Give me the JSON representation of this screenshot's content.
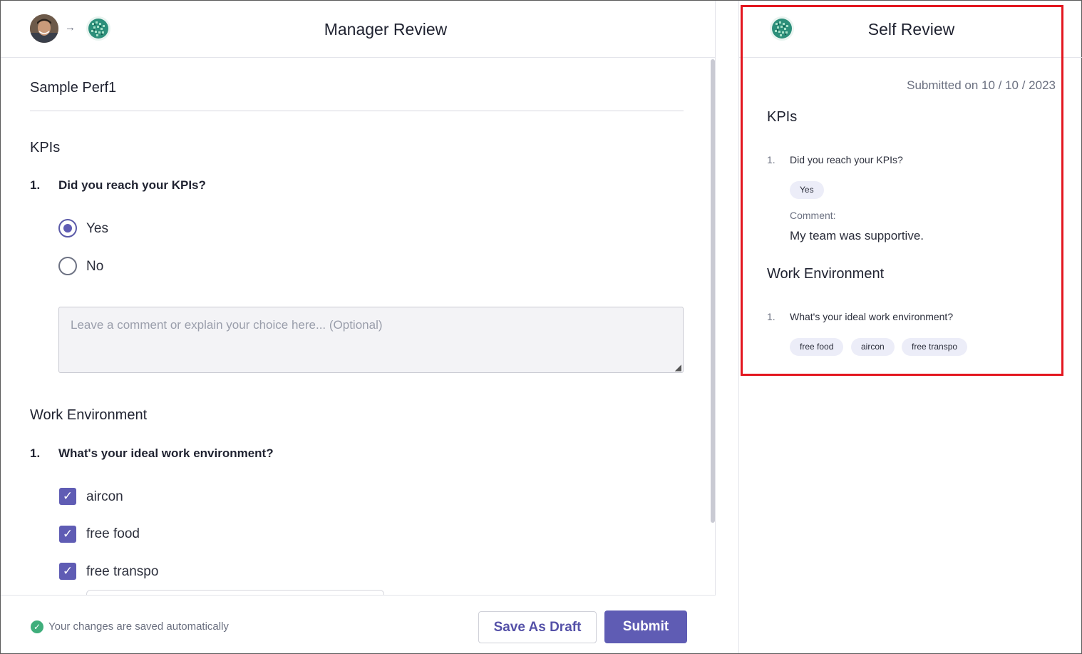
{
  "manager_review": {
    "header": {
      "title": "Manager Review"
    },
    "form_title": "Sample Perf1",
    "sections": [
      {
        "heading": "KPIs",
        "question_number": "1.",
        "question": "Did you reach your KPIs?",
        "options": [
          {
            "label": "Yes",
            "selected": true
          },
          {
            "label": "No",
            "selected": false
          }
        ],
        "comment_placeholder": "Leave a comment or explain your choice here... (Optional)"
      },
      {
        "heading": "Work Environment",
        "question_number": "1.",
        "question": "What's your ideal work environment?",
        "options": [
          {
            "label": "aircon",
            "checked": true
          },
          {
            "label": "free food",
            "checked": true
          },
          {
            "label": "free transpo",
            "checked": true
          }
        ]
      }
    ],
    "footer": {
      "saved_text": "Your changes are saved automatically",
      "draft_label": "Save As Draft",
      "submit_label": "Submit"
    }
  },
  "self_review": {
    "header": {
      "title": "Self Review"
    },
    "submitted_text": "Submitted on 10 / 10 / 2023",
    "sections": [
      {
        "heading": "KPIs",
        "question_number": "1.",
        "question": "Did you reach your KPIs?",
        "answer": "Yes",
        "comment_label": "Comment:",
        "comment": "My team was supportive."
      },
      {
        "heading": "Work Environment",
        "question_number": "1.",
        "question": "What's your ideal work environment?",
        "answers": [
          "free food",
          "aircon",
          "free transpo"
        ]
      }
    ]
  },
  "colors": {
    "accent": "#5f5cb4",
    "highlight": "#e3161f",
    "success": "#3fae7b",
    "pill_bg": "#ecedf8"
  },
  "icons": {
    "arrow": "arrow-right-icon",
    "check": "check-icon",
    "saved": "check-circle-icon",
    "resize": "resize-handle-icon"
  }
}
